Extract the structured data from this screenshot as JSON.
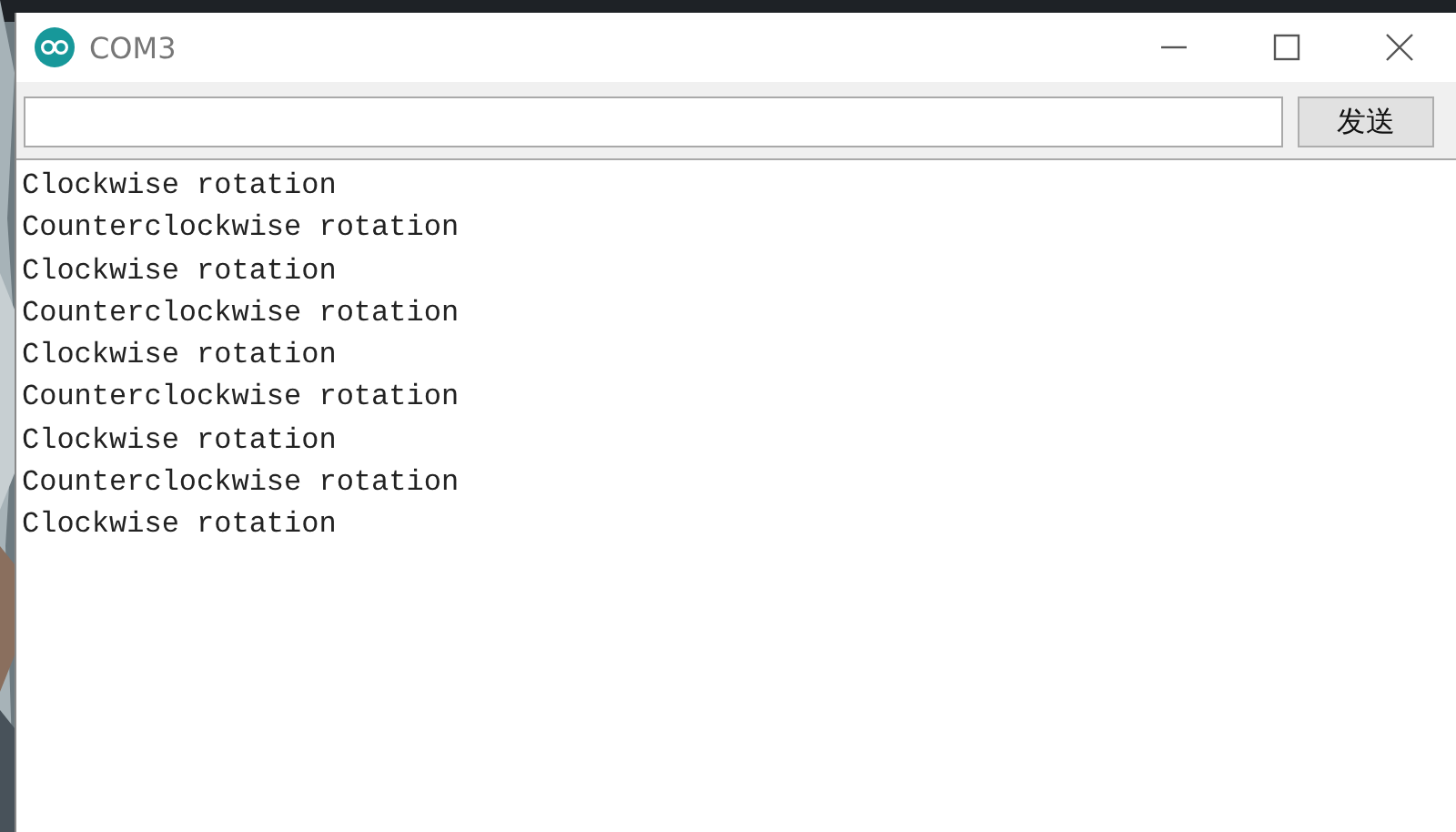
{
  "window": {
    "title": "COM3"
  },
  "send_button": {
    "label": "发送"
  },
  "output_lines": [
    "Clockwise rotation",
    "Counterclockwise rotation",
    "Clockwise rotation",
    "Counterclockwise rotation",
    "Clockwise rotation",
    "Counterclockwise rotation",
    "Clockwise rotation",
    "Counterclockwise rotation",
    "Clockwise rotation"
  ]
}
